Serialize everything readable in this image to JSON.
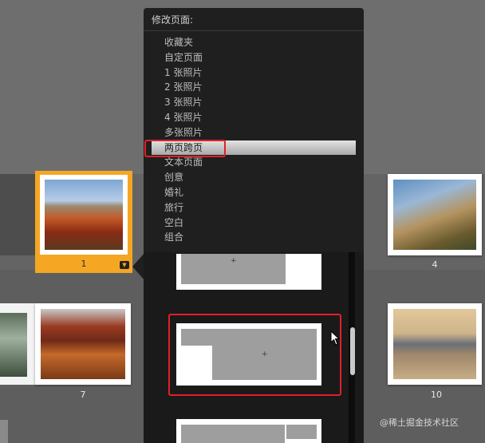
{
  "panel": {
    "title": "修改页面:",
    "menu_items": [
      {
        "label": "收藏夹"
      },
      {
        "label": "自定页面"
      },
      {
        "label": "1 张照片"
      },
      {
        "label": "2 张照片"
      },
      {
        "label": "3 张照片"
      },
      {
        "label": "4 张照片"
      },
      {
        "label": "多张照片"
      },
      {
        "label": "两页跨页",
        "selected": true
      },
      {
        "label": "文本页面"
      },
      {
        "label": "创意"
      },
      {
        "label": "婚礼"
      },
      {
        "label": "旅行"
      },
      {
        "label": "空白"
      },
      {
        "label": "组合"
      }
    ]
  },
  "pages": {
    "selected_number": "1",
    "page7_number": "7",
    "page4_number": "4",
    "page10_number": "10"
  },
  "watermark": "@稀土掘金技术社区",
  "colors": {
    "selection_accent": "#f5a623",
    "highlight_red": "#e0202a",
    "panel_bg": "#1f1f1f"
  }
}
